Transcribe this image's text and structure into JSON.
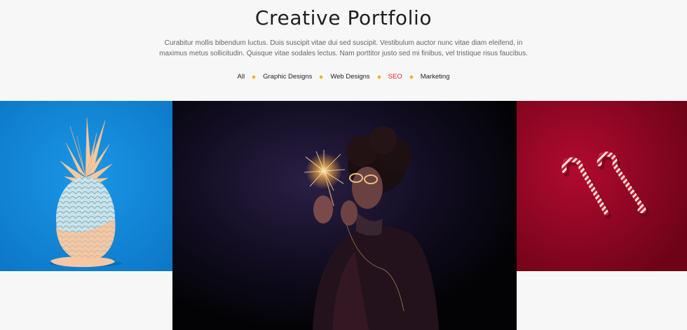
{
  "header": {
    "title": "Creative Portfolio",
    "description": "Curabitur mollis bibendum luctus. Duis suscipit vitae dui sed suscipit. Vestibulum auctor nunc vitae diam eleifend, in maximus metus sollicitudin. Quisque vitae sodales lectus. Nam porttitor justo sed mi finibus, vel tristique risus faucibus."
  },
  "filters": [
    {
      "label": "All",
      "active": false
    },
    {
      "label": "Graphic Designs",
      "active": false
    },
    {
      "label": "Web Designs",
      "active": false
    },
    {
      "label": "SEO",
      "active": true
    },
    {
      "label": "Marketing",
      "active": false
    }
  ],
  "colors": {
    "accent_active": "#e8232c",
    "separator": "#f0b400",
    "background": "#f7f7f7"
  },
  "portfolio": [
    {
      "image": "pineapple-on-blue-image"
    },
    {
      "image": "person-with-sparkler-image"
    },
    {
      "image": "candy-canes-on-red-image"
    }
  ]
}
